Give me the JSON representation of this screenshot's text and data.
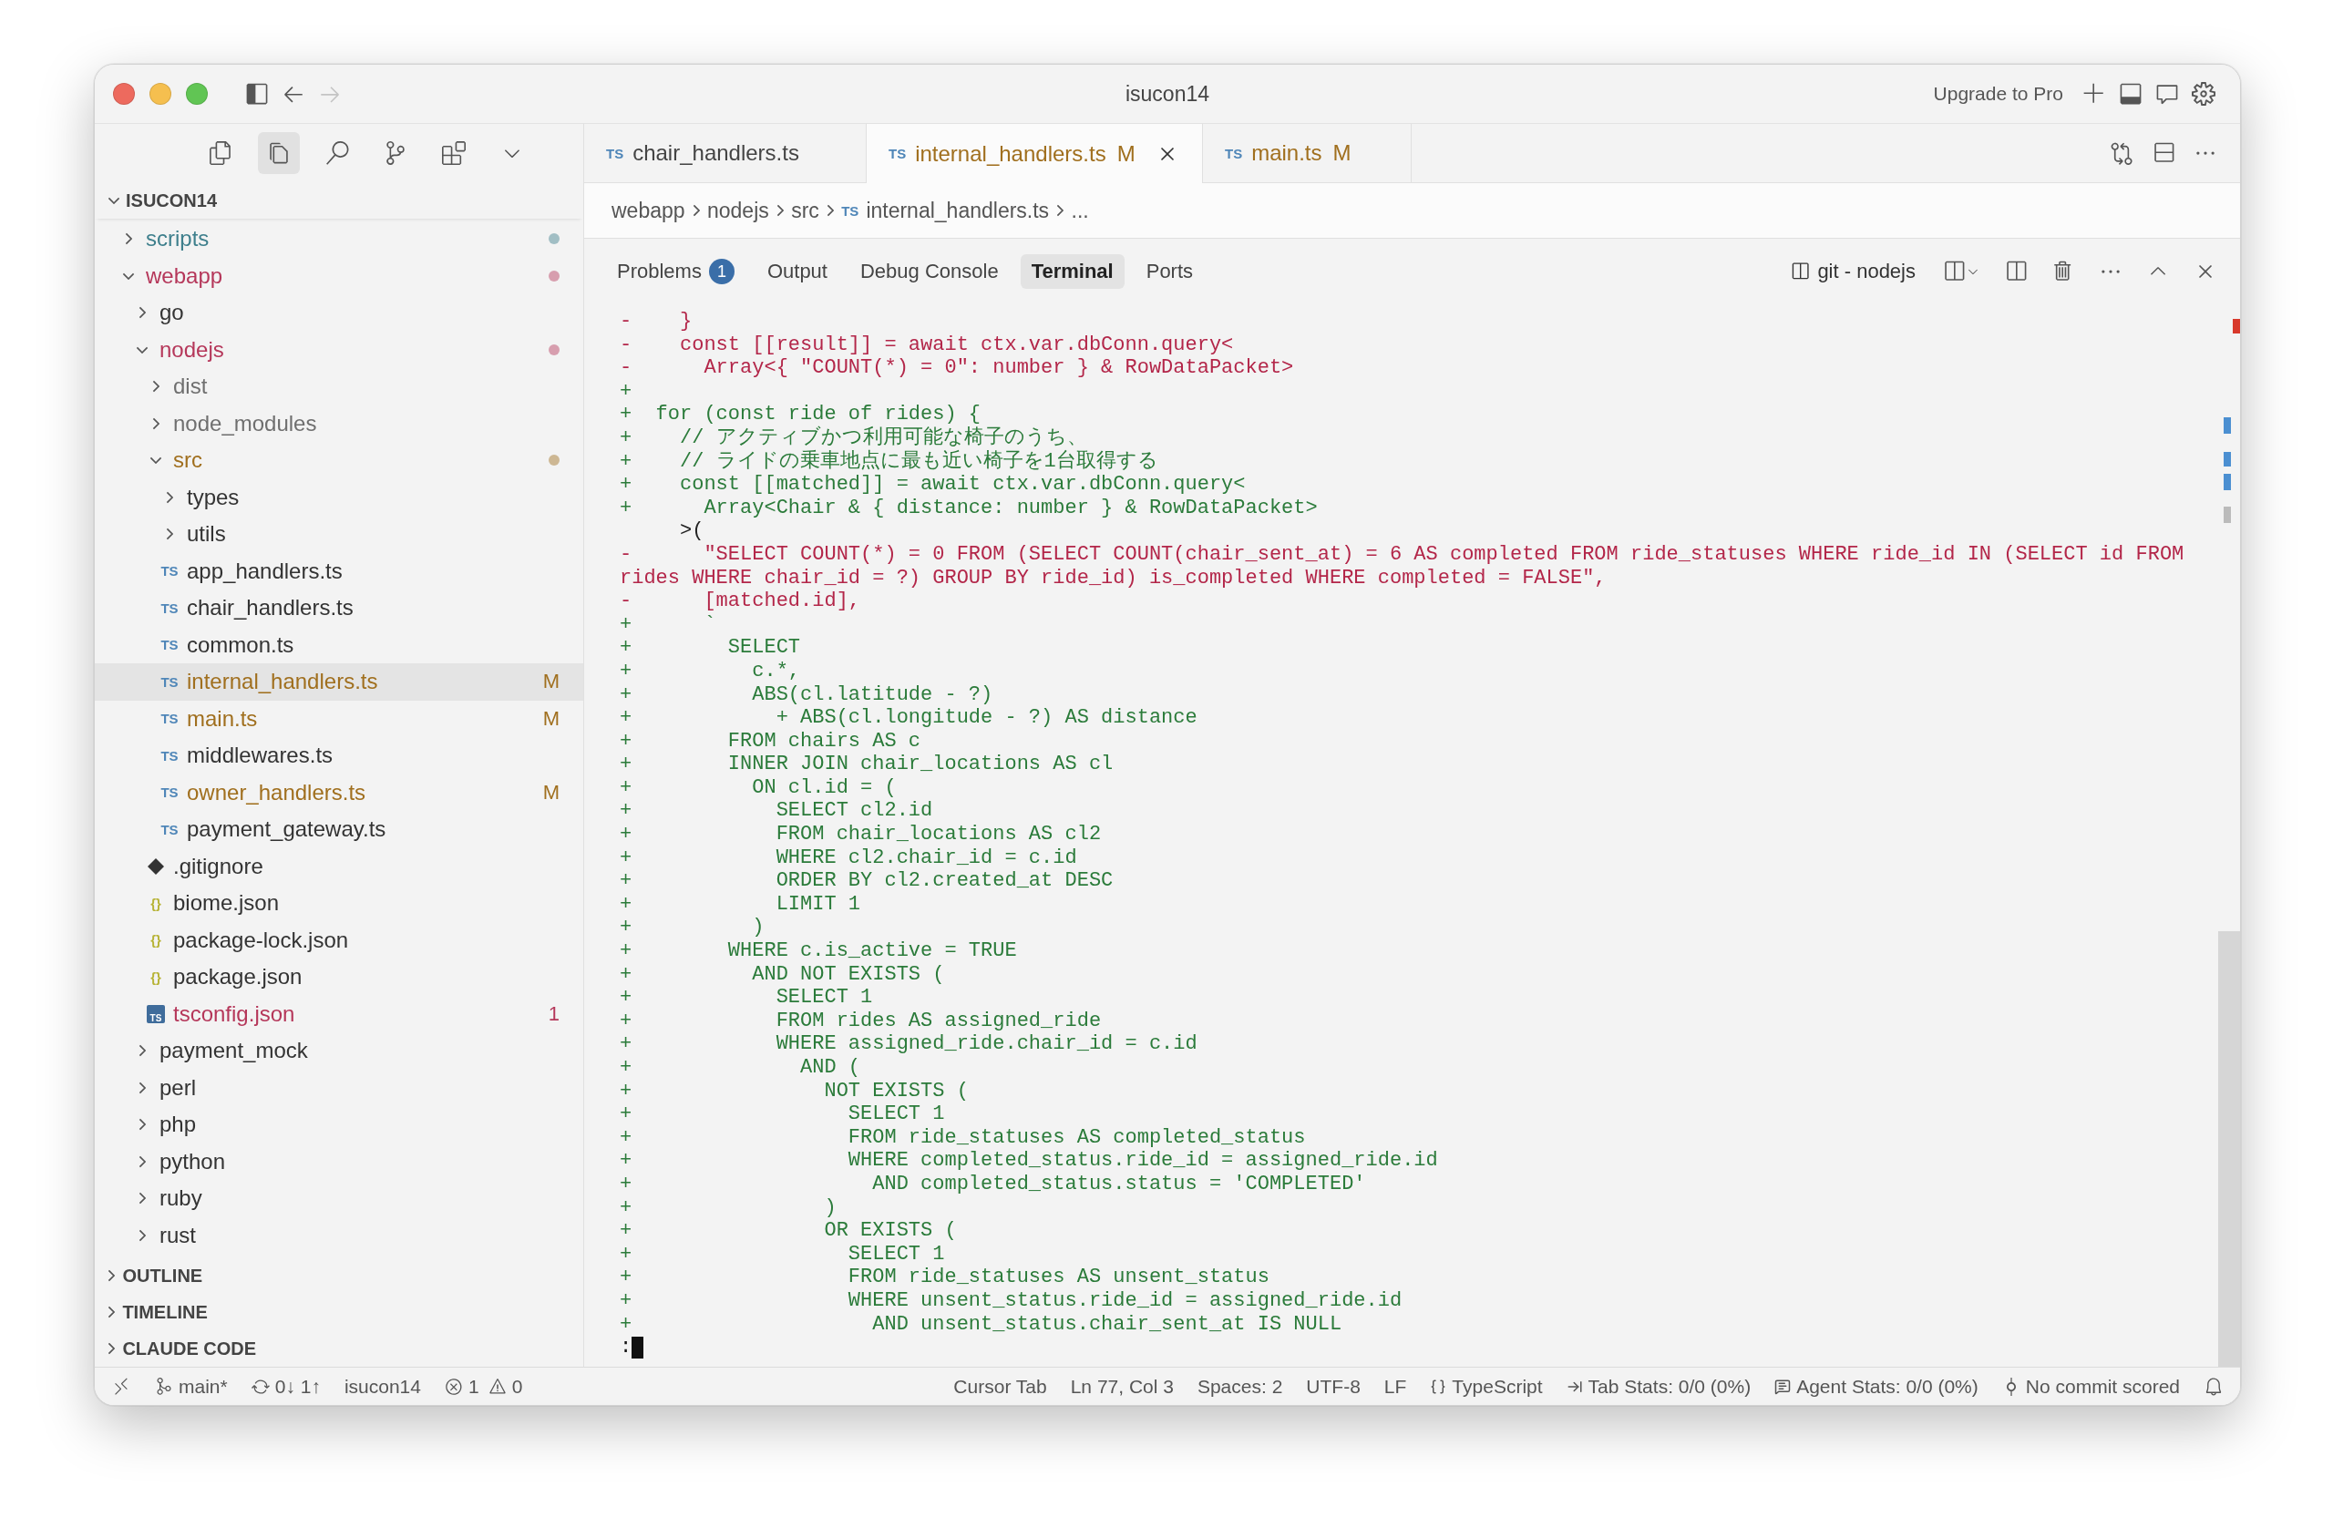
{
  "title_bar": {
    "title": "isucon14",
    "upgrade": "Upgrade to Pro",
    "nav_buttons": [
      {
        "kind": "back",
        "disabled": false
      },
      {
        "kind": "forward",
        "disabled": true
      }
    ]
  },
  "activity_icons": [
    {
      "kind": "files",
      "selected": false
    },
    {
      "kind": "pages",
      "selected": true
    },
    {
      "kind": "search",
      "selected": false
    },
    {
      "kind": "branch",
      "selected": false
    },
    {
      "kind": "blocks",
      "selected": false
    },
    {
      "kind": "more",
      "selected": false
    }
  ],
  "explorer": {
    "root": "ISUCON14",
    "expanded": true,
    "items": [
      {
        "name": "scripts",
        "kind": "folder",
        "expanded": false,
        "selected": false,
        "color": "#3e7f8c",
        "dot": true
      },
      {
        "name": "webapp",
        "kind": "folder",
        "expanded": true,
        "selected": false,
        "color": "#b5375a",
        "dot": true,
        "children": [
          {
            "name": "go",
            "kind": "folder",
            "expanded": false,
            "selected": false
          },
          {
            "name": "nodejs",
            "kind": "folder",
            "expanded": true,
            "selected": false,
            "color": "#b5375a",
            "dot": true,
            "children": [
              {
                "name": "dist",
                "kind": "folder",
                "expanded": false,
                "selected": false,
                "color": "#6f6f6f"
              },
              {
                "name": "node_modules",
                "kind": "folder",
                "expanded": false,
                "selected": false,
                "color": "#6f6f6f"
              },
              {
                "name": "src",
                "kind": "folder",
                "expanded": true,
                "selected": false,
                "color": "#a06f1e",
                "dot": true,
                "children": [
                  {
                    "name": "types",
                    "kind": "folder",
                    "expanded": false,
                    "selected": false
                  },
                  {
                    "name": "utils",
                    "kind": "folder",
                    "expanded": false,
                    "selected": false
                  },
                  {
                    "name": "app_handlers.ts",
                    "kind": "file",
                    "icon": {
                      "kind": "ts",
                      "text": "TS"
                    },
                    "selected": false
                  },
                  {
                    "name": "chair_handlers.ts",
                    "kind": "file",
                    "icon": {
                      "kind": "ts",
                      "text": "TS"
                    },
                    "selected": false
                  },
                  {
                    "name": "common.ts",
                    "kind": "file",
                    "icon": {
                      "kind": "ts",
                      "text": "TS"
                    },
                    "selected": false
                  },
                  {
                    "name": "internal_handlers.ts",
                    "kind": "file",
                    "icon": {
                      "kind": "ts",
                      "text": "TS"
                    },
                    "selected": true,
                    "color": "#a06f1e",
                    "badge": "M"
                  },
                  {
                    "name": "main.ts",
                    "kind": "file",
                    "icon": {
                      "kind": "ts",
                      "text": "TS"
                    },
                    "selected": false,
                    "color": "#a06f1e",
                    "badge": "M"
                  },
                  {
                    "name": "middlewares.ts",
                    "kind": "file",
                    "icon": {
                      "kind": "ts",
                      "text": "TS"
                    },
                    "selected": false
                  },
                  {
                    "name": "owner_handlers.ts",
                    "kind": "file",
                    "icon": {
                      "kind": "ts",
                      "text": "TS"
                    },
                    "selected": false,
                    "color": "#a06f1e",
                    "badge": "M"
                  },
                  {
                    "name": "payment_gateway.ts",
                    "kind": "file",
                    "icon": {
                      "kind": "ts",
                      "text": "TS"
                    },
                    "selected": false
                  }
                ]
              },
              {
                "name": ".gitignore",
                "kind": "file",
                "icon": {
                  "kind": "git"
                },
                "selected": false
              },
              {
                "name": "biome.json",
                "kind": "file",
                "icon": {
                  "kind": "json",
                  "text": "{}"
                },
                "selected": false
              },
              {
                "name": "package-lock.json",
                "kind": "file",
                "icon": {
                  "kind": "json",
                  "text": "{}"
                },
                "selected": false
              },
              {
                "name": "package.json",
                "kind": "file",
                "icon": {
                  "kind": "json",
                  "text": "{}"
                },
                "selected": false
              },
              {
                "name": "tsconfig.json",
                "kind": "file",
                "icon": {
                  "kind": "tsconfig",
                  "text": "TS"
                },
                "selected": false,
                "color": "#b5375a",
                "badge": "1"
              }
            ]
          },
          {
            "name": "payment_mock",
            "kind": "folder",
            "expanded": false,
            "selected": false
          },
          {
            "name": "perl",
            "kind": "folder",
            "expanded": false,
            "selected": false
          },
          {
            "name": "php",
            "kind": "folder",
            "expanded": false,
            "selected": false
          },
          {
            "name": "python",
            "kind": "folder",
            "expanded": false,
            "selected": false
          },
          {
            "name": "ruby",
            "kind": "folder",
            "expanded": false,
            "selected": false
          },
          {
            "name": "rust",
            "kind": "folder",
            "expanded": false,
            "selected": false
          }
        ]
      }
    ]
  },
  "sections": [
    {
      "label": "OUTLINE",
      "expanded": false
    },
    {
      "label": "TIMELINE",
      "expanded": false
    },
    {
      "label": "CLAUDE CODE",
      "expanded": false
    }
  ],
  "editor_tabs": [
    {
      "label": "chair_handlers.ts",
      "icon_text": "TS",
      "selected": false
    },
    {
      "label": "internal_handlers.ts",
      "icon_text": "TS",
      "selected": true,
      "status": "M"
    },
    {
      "label": "main.ts",
      "icon_text": "TS",
      "selected": false,
      "status": "M"
    }
  ],
  "breadcrumb": [
    {
      "label": "webapp"
    },
    {
      "label": "nodejs"
    },
    {
      "label": "src"
    },
    {
      "label": "internal_handlers.ts",
      "icon_text": "TS"
    },
    {
      "label": "..."
    }
  ],
  "panel_tabs": [
    {
      "label": "Problems",
      "badge": "1",
      "selected": false
    },
    {
      "label": "Output",
      "selected": false
    },
    {
      "label": "Debug Console",
      "selected": false
    },
    {
      "label": "Terminal",
      "selected": true
    },
    {
      "label": "Ports",
      "selected": false
    }
  ],
  "terminal": {
    "name": "git - nodejs",
    "prompt": ":",
    "lines": [
      {
        "kind": "removed",
        "sign": "-",
        "text": "    }"
      },
      {
        "kind": "removed",
        "sign": "-",
        "text": "    const [[result]] = await ctx.var.dbConn.query<"
      },
      {
        "kind": "removed",
        "sign": "-",
        "text": "      Array<{ \"COUNT(*) = 0\": number } & RowDataPacket>"
      },
      {
        "kind": "added",
        "sign": "+"
      },
      {
        "kind": "added",
        "sign": "+",
        "text": "  for (const ride of rides) {"
      },
      {
        "kind": "added",
        "sign": "+",
        "text": "    // アクティブかつ利用可能な椅子のうち、"
      },
      {
        "kind": "added",
        "sign": "+",
        "text": "    // ライドの乗車地点に最も近い椅子を1台取得する"
      },
      {
        "kind": "added",
        "sign": "+",
        "text": "    const [[matched]] = await ctx.var.dbConn.query<"
      },
      {
        "kind": "added",
        "sign": "+",
        "text": "      Array<Chair & { distance: number } & RowDataPacket>"
      },
      {
        "kind": "context",
        "text": "     >("
      },
      {
        "kind": "removed",
        "sign": "-",
        "text": "      \"SELECT COUNT(*) = 0 FROM (SELECT COUNT(chair_sent_at) = 6 AS completed FROM ride_statuses WHERE ride_id IN (SELECT id FROM"
      },
      {
        "kind": "removed",
        "text": "rides WHERE chair_id = ?) GROUP BY ride_id) is_completed WHERE completed = FALSE\","
      },
      {
        "kind": "removed",
        "sign": "-",
        "text": "      [matched.id],"
      },
      {
        "kind": "added",
        "sign": "+",
        "text": "      `"
      },
      {
        "kind": "added",
        "sign": "+",
        "text": "        SELECT"
      },
      {
        "kind": "added",
        "sign": "+",
        "text": "          c.*,"
      },
      {
        "kind": "added",
        "sign": "+",
        "text": "          ABS(cl.latitude - ?)"
      },
      {
        "kind": "added",
        "sign": "+",
        "text": "            + ABS(cl.longitude - ?) AS distance"
      },
      {
        "kind": "added",
        "sign": "+",
        "text": "        FROM chairs AS c"
      },
      {
        "kind": "added",
        "sign": "+",
        "text": "        INNER JOIN chair_locations AS cl"
      },
      {
        "kind": "added",
        "sign": "+",
        "text": "          ON cl.id = ("
      },
      {
        "kind": "added",
        "sign": "+",
        "text": "            SELECT cl2.id"
      },
      {
        "kind": "added",
        "sign": "+",
        "text": "            FROM chair_locations AS cl2"
      },
      {
        "kind": "added",
        "sign": "+",
        "text": "            WHERE cl2.chair_id = c.id"
      },
      {
        "kind": "added",
        "sign": "+",
        "text": "            ORDER BY cl2.created_at DESC"
      },
      {
        "kind": "added",
        "sign": "+",
        "text": "            LIMIT 1"
      },
      {
        "kind": "added",
        "sign": "+",
        "text": "          )"
      },
      {
        "kind": "added",
        "sign": "+",
        "text": "        WHERE c.is_active = TRUE"
      },
      {
        "kind": "added",
        "sign": "+",
        "text": "          AND NOT EXISTS ("
      },
      {
        "kind": "added",
        "sign": "+",
        "text": "            SELECT 1"
      },
      {
        "kind": "added",
        "sign": "+",
        "text": "            FROM rides AS assigned_ride"
      },
      {
        "kind": "added",
        "sign": "+",
        "text": "            WHERE assigned_ride.chair_id = c.id"
      },
      {
        "kind": "added",
        "sign": "+",
        "text": "              AND ("
      },
      {
        "kind": "added",
        "sign": "+",
        "text": "                NOT EXISTS ("
      },
      {
        "kind": "added",
        "sign": "+",
        "text": "                  SELECT 1"
      },
      {
        "kind": "added",
        "sign": "+",
        "text": "                  FROM ride_statuses AS completed_status"
      },
      {
        "kind": "added",
        "sign": "+",
        "text": "                  WHERE completed_status.ride_id = assigned_ride.id"
      },
      {
        "kind": "added",
        "sign": "+",
        "text": "                    AND completed_status.status = 'COMPLETED'"
      },
      {
        "kind": "added",
        "sign": "+",
        "text": "                )"
      },
      {
        "kind": "added",
        "sign": "+",
        "text": "                OR EXISTS ("
      },
      {
        "kind": "added",
        "sign": "+",
        "text": "                  SELECT 1"
      },
      {
        "kind": "added",
        "sign": "+",
        "text": "                  FROM ride_statuses AS unsent_status"
      },
      {
        "kind": "added",
        "sign": "+",
        "text": "                  WHERE unsent_status.ride_id = assigned_ride.id"
      },
      {
        "kind": "added",
        "sign": "+",
        "text": "                    AND unsent_status.chair_sent_at IS NULL"
      }
    ]
  },
  "status_bar": {
    "left": [
      {
        "kind": "remote"
      },
      {
        "kind": "branch",
        "text": "main*"
      },
      {
        "kind": "sync",
        "text": "0↓ 1↑"
      },
      {
        "kind": "plain",
        "text": "isucon14"
      },
      {
        "kind": "errors",
        "text": "1"
      },
      {
        "kind": "warnings",
        "text": "0"
      }
    ],
    "right": [
      {
        "kind": "plain",
        "text": "Cursor Tab"
      },
      {
        "kind": "plain",
        "text": "Ln 77, Col 3"
      },
      {
        "kind": "plain",
        "text": "Spaces: 2"
      },
      {
        "kind": "plain",
        "text": "UTF-8"
      },
      {
        "kind": "plain",
        "text": "LF"
      },
      {
        "kind": "language",
        "text": "TypeScript"
      },
      {
        "kind": "tabstats",
        "text": "Tab Stats: 0/0 (0%)"
      },
      {
        "kind": "agent",
        "text": "Agent Stats: 0/0 (0%)"
      },
      {
        "kind": "commit",
        "text": "No commit scored"
      },
      {
        "kind": "bell"
      }
    ]
  }
}
